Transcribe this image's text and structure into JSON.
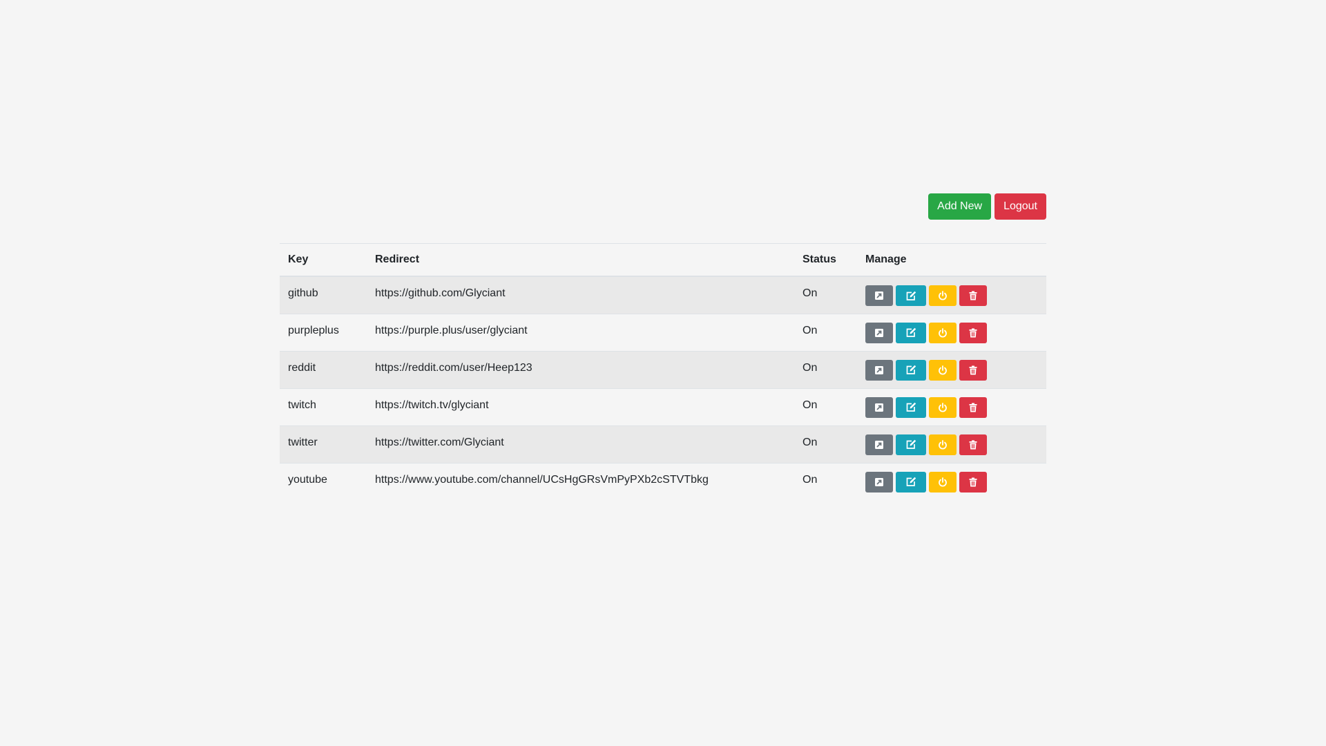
{
  "toolbar": {
    "add_label": "Add New",
    "logout_label": "Logout"
  },
  "table": {
    "headers": {
      "key": "Key",
      "redirect": "Redirect",
      "status": "Status",
      "manage": "Manage"
    },
    "rows": [
      {
        "key": "github",
        "redirect": "https://github.com/Glyciant",
        "status": "On"
      },
      {
        "key": "purpleplus",
        "redirect": "https://purple.plus/user/glyciant",
        "status": "On"
      },
      {
        "key": "reddit",
        "redirect": "https://reddit.com/user/Heep123",
        "status": "On"
      },
      {
        "key": "twitch",
        "redirect": "https://twitch.tv/glyciant",
        "status": "On"
      },
      {
        "key": "twitter",
        "redirect": "https://twitter.com/Glyciant",
        "status": "On"
      },
      {
        "key": "youtube",
        "redirect": "https://www.youtube.com/channel/UCsHgGRsVmPyPXb2cSTVTbkg",
        "status": "On"
      }
    ]
  },
  "icons": {
    "open": "external-link-icon",
    "edit": "edit-icon",
    "toggle": "power-icon",
    "delete": "trash-icon"
  },
  "colors": {
    "add": "#28a745",
    "logout": "#dc3545",
    "open": "#6c757d",
    "edit": "#17a2b8",
    "toggle": "#ffc107",
    "delete": "#dc3545"
  }
}
